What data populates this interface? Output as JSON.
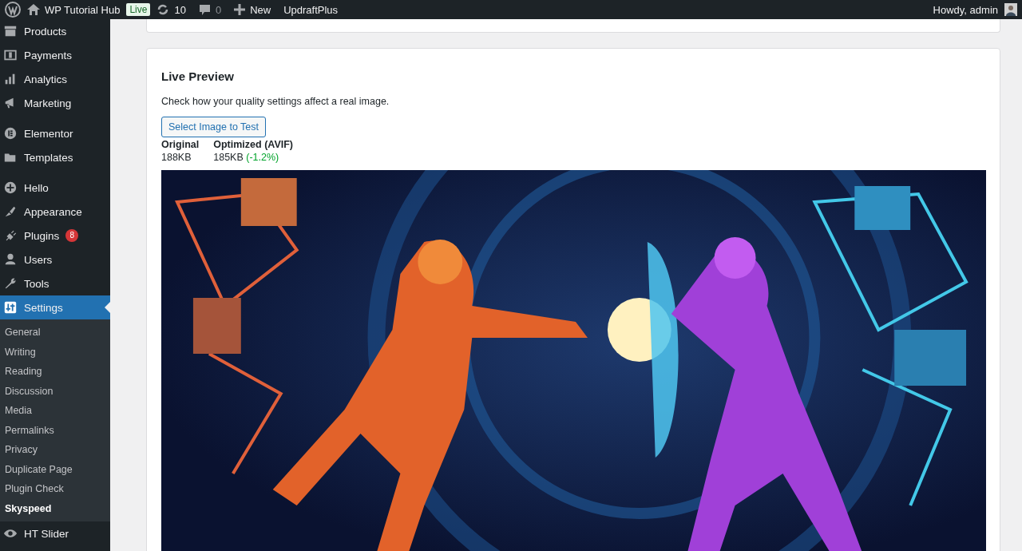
{
  "admin_bar": {
    "site": "WP Tutorial Hub",
    "site_badge": "Live",
    "updates": "10",
    "comments": "0",
    "new": "New",
    "plugin_link": "UpdraftPlus",
    "account": "Howdy, admin"
  },
  "sidebar": {
    "groups": [
      {
        "items": [
          {
            "label": "Products",
            "selected": false
          },
          {
            "label": "Payments",
            "selected": false
          },
          {
            "label": "Analytics",
            "selected": false
          },
          {
            "label": "Marketing",
            "selected": false
          }
        ]
      },
      {
        "items": [
          {
            "label": "Elementor",
            "selected": false
          },
          {
            "label": "Templates",
            "selected": false
          }
        ]
      },
      {
        "items": [
          {
            "label": "Hello",
            "selected": false
          },
          {
            "label": "Appearance",
            "selected": false
          },
          {
            "label": "Plugins",
            "selected": false,
            "badge": "8"
          },
          {
            "label": "Users",
            "selected": false
          },
          {
            "label": "Tools",
            "selected": false
          },
          {
            "label": "Settings",
            "selected": true,
            "children": [
              {
                "label": "General",
                "selected": false
              },
              {
                "label": "Writing",
                "selected": false
              },
              {
                "label": "Reading",
                "selected": false
              },
              {
                "label": "Discussion",
                "selected": false
              },
              {
                "label": "Media",
                "selected": false
              },
              {
                "label": "Permalinks",
                "selected": false
              },
              {
                "label": "Privacy",
                "selected": false
              },
              {
                "label": "Duplicate Page",
                "selected": false
              },
              {
                "label": "Plugin Check",
                "selected": false
              },
              {
                "label": "Skyspeed",
                "selected": true
              }
            ]
          },
          {
            "label": "HT Slider",
            "selected": false
          }
        ]
      }
    ]
  },
  "live_preview": {
    "title": "Live Preview",
    "description": "Check how your quality settings affect a real image.",
    "button": "Select Image to Test",
    "stats": [
      {
        "label": "Original",
        "value": "188KB"
      },
      {
        "label": "Optimized (AVIF)",
        "value": "185KB",
        "change": "(-1.2%)"
      }
    ]
  }
}
